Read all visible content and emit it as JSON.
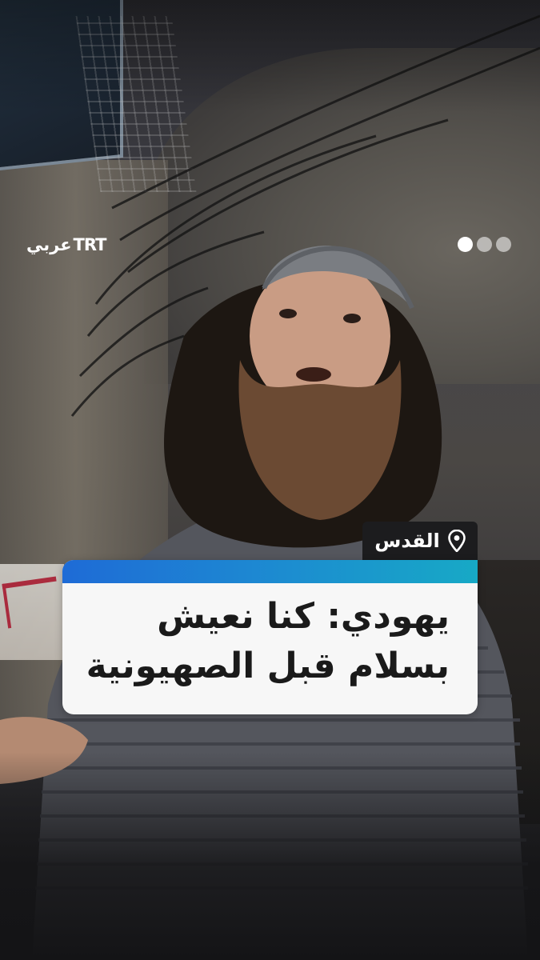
{
  "branding": {
    "logo_arabic": "عربي",
    "logo_trt": "TRT"
  },
  "carousel": {
    "count": 3,
    "active_index": 0
  },
  "location": {
    "icon": "map-pin-icon",
    "label": "القدس"
  },
  "headline": {
    "lines": [
      "يهودي: كنا نعيش",
      "بسلام قبل الصهيونية"
    ]
  },
  "colors": {
    "accent_start": "#1e6bd6",
    "accent_end": "#17a9c6",
    "card_background": "#f7f7f7",
    "tag_background": "#1c1c1e",
    "text_dark": "#1a1a1a",
    "text_light": "#ffffff"
  }
}
